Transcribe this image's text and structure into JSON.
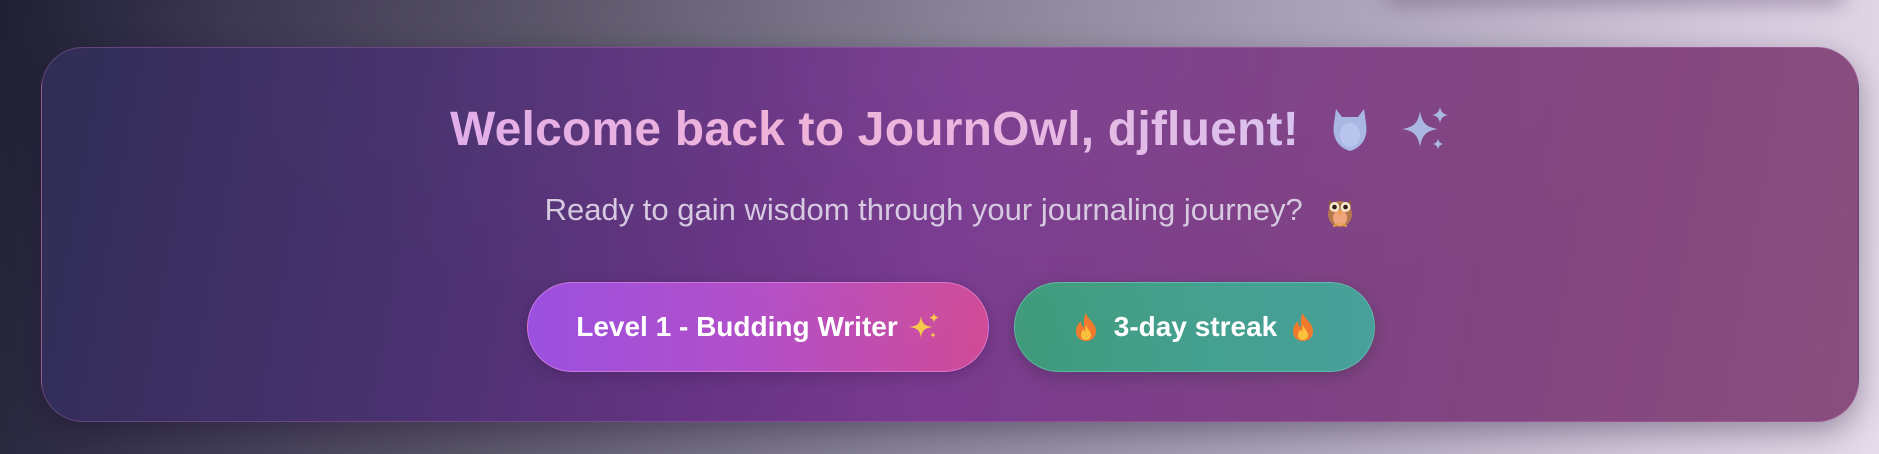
{
  "banner": {
    "title": "Welcome back to JournOwl, djfluent!",
    "title_icons": [
      "owl-icon",
      "sparkles-icon"
    ],
    "subtitle": "Ready to gain wisdom through your journaling journey?",
    "subtitle_icon": "owl-emoji-icon"
  },
  "badges": {
    "level": {
      "label": "Level 1 - Budding Writer",
      "icon": "sparkles-icon"
    },
    "streak": {
      "label": "3-day streak",
      "icon": "fire-icon"
    }
  },
  "colors": {
    "card_gradient_start": "#2f2d55",
    "card_gradient_end": "#8a4e7d",
    "title_gradient_start": "#e2aeea",
    "title_gradient_end": "#d9c1ee",
    "level_pill_start": "#9b50df",
    "level_pill_end": "#d04b96",
    "streak_pill": "#44a08e",
    "subtitle_text": "#d5c8e0"
  }
}
